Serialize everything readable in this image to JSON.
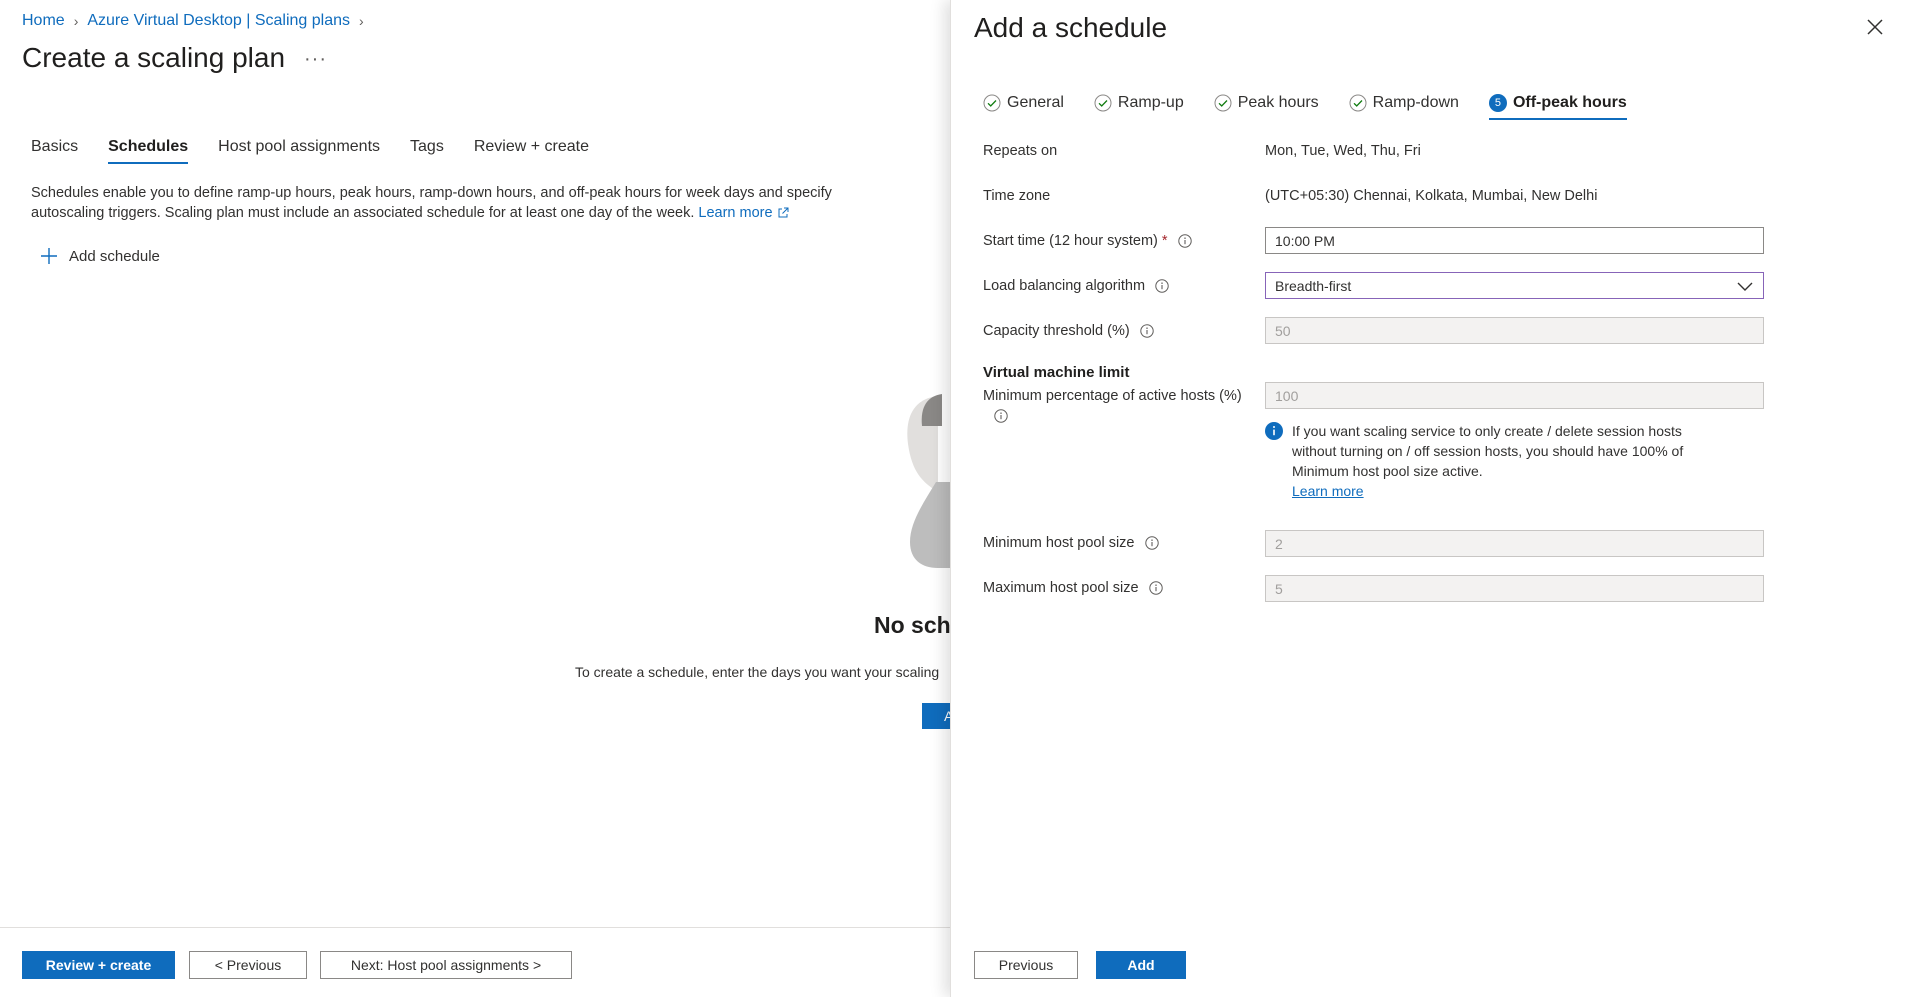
{
  "breadcrumb": {
    "home": "Home",
    "parent": "Azure Virtual Desktop | Scaling plans"
  },
  "page": {
    "title": "Create a scaling plan",
    "more": "···"
  },
  "tabs": [
    {
      "label": "Basics"
    },
    {
      "label": "Schedules"
    },
    {
      "label": "Host pool assignments"
    },
    {
      "label": "Tags"
    },
    {
      "label": "Review + create"
    }
  ],
  "description": {
    "text": "Schedules enable you to define ramp-up hours, peak hours, ramp-down hours, and off-peak hours for week days and specify autoscaling triggers. Scaling plan must include an associated schedule for at least one day of the week. ",
    "link": "Learn more"
  },
  "add_schedule": "Add schedule",
  "empty_state": {
    "title": "No sche",
    "desc": "To create a schedule, enter the days you want your scaling",
    "button": "A"
  },
  "footer": {
    "review_create": "Review + create",
    "previous": "< Previous",
    "next": "Next: Host pool assignments >"
  },
  "panel": {
    "title": "Add a schedule",
    "steps": [
      {
        "label": "General"
      },
      {
        "label": "Ramp-up"
      },
      {
        "label": "Peak hours"
      },
      {
        "label": "Ramp-down"
      },
      {
        "label": "Off-peak hours",
        "number": "5"
      }
    ],
    "repeats_on": {
      "label": "Repeats on",
      "value": "Mon, Tue, Wed, Thu, Fri"
    },
    "time_zone": {
      "label": "Time zone",
      "value": "(UTC+05:30) Chennai, Kolkata, Mumbai, New Delhi"
    },
    "start_time": {
      "label": "Start time (12 hour system)",
      "required": "*",
      "value": "10:00 PM"
    },
    "load_balancing": {
      "label": "Load balancing algorithm",
      "value": "Breadth-first"
    },
    "capacity": {
      "label": "Capacity threshold (%)",
      "value": "50"
    },
    "vm_limit": {
      "heading": "Virtual machine limit",
      "min_active_label": "Minimum percentage of active hosts (%)",
      "min_active_value": "100",
      "info_text": "If you want scaling service to only create / delete session hosts without turning on / off session hosts, you should have 100% of Minimum host pool size active.",
      "info_link": "Learn more"
    },
    "min_pool": {
      "label": "Minimum host pool size",
      "value": "2"
    },
    "max_pool": {
      "label": "Maximum host pool size",
      "value": "5"
    },
    "buttons": {
      "previous": "Previous",
      "add": "Add"
    }
  },
  "colors": {
    "accent": "#0f6cbd",
    "select_border": "#8764b8"
  }
}
